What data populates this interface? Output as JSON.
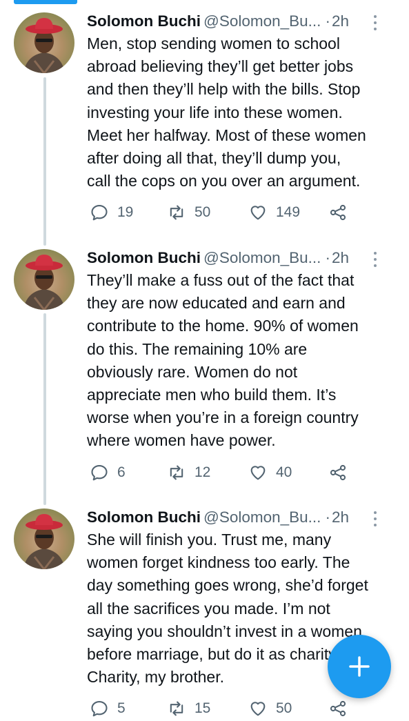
{
  "tweets": [
    {
      "author": "Solomon Buchi",
      "handle": "@Solomon_Bu...",
      "separator": "·",
      "time": "2h",
      "text_lines": [
        "Men, stop sending women to school",
        "abroad believing they’ll get better jobs",
        "and then they’ll help with the bills. Stop",
        "investing your life into these women.",
        "Meet her halfway. Most of these women",
        "after doing all that, they’ll dump you,",
        "call the cops on you over an argument."
      ],
      "replies": "19",
      "retweets": "50",
      "likes": "149"
    },
    {
      "author": "Solomon Buchi",
      "handle": "@Solomon_Bu...",
      "separator": "·",
      "time": "2h",
      "text_lines": [
        "They’ll make a fuss out of the fact that",
        "they are now educated and earn and",
        "contribute to the home. 90% of women",
        "do this.  The remaining 10% are",
        "obviously rare. Women do not",
        "appreciate men who build them. It’s",
        "worse when you’re in a foreign country",
        "where women have power."
      ],
      "replies": "6",
      "retweets": "12",
      "likes": "40"
    },
    {
      "author": "Solomon Buchi",
      "handle": "@Solomon_Bu...",
      "separator": "·",
      "time": "2h",
      "text_lines": [
        "She will finish you. Trust me, many",
        "women forget kindness too early. The",
        "day something goes wrong, she’d forget",
        "all the sacrifices you made. I’m not",
        "saying you shouldn’t invest in a women",
        "before marriage, but do it as charity.",
        "Charity, my brother."
      ],
      "replies": "5",
      "retweets": "15",
      "likes": "50"
    }
  ],
  "icons": {
    "reply": "reply-icon",
    "retweet": "retweet-icon",
    "like": "heart-icon",
    "share": "share-icon",
    "compose": "plus-icon",
    "more": "more-vertical-icon"
  },
  "colors": {
    "accent": "#1d9bf0",
    "secondary_text": "#536471",
    "thread_line": "#cfd9de"
  }
}
